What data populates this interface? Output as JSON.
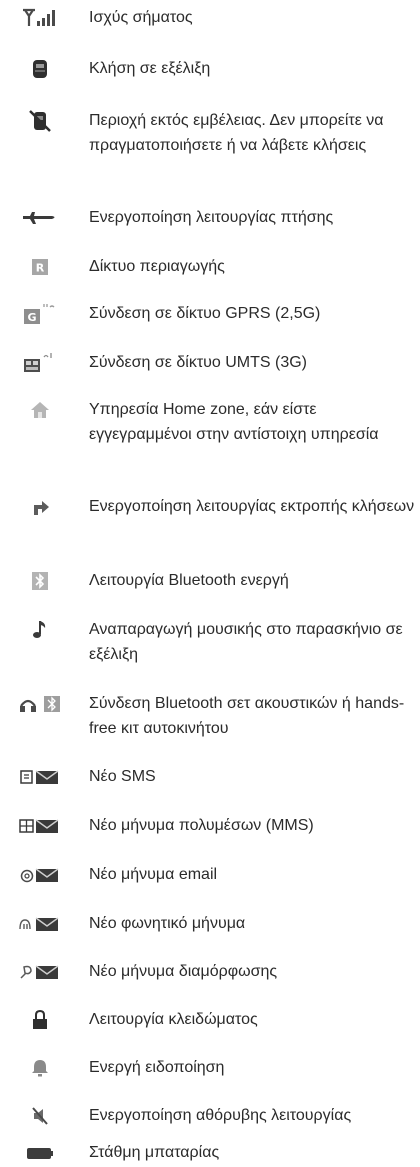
{
  "items": [
    {
      "icon": "signal-strength-icon",
      "text": "Ισχύς σήματος"
    },
    {
      "icon": "call-in-progress-icon",
      "text": "Κλήση σε εξέλιξη"
    },
    {
      "icon": "no-network-icon",
      "text": "Περιοχή εκτός εμβέλειας. Δεν μπορείτε να πραγματοποιήσετε ή να λάβετε κλήσεις"
    },
    {
      "icon": "airplane-mode-icon",
      "text": "Ενεργοποίηση λειτουργίας πτήσης"
    },
    {
      "icon": "roaming-icon",
      "text": "Δίκτυο περιαγωγής"
    },
    {
      "icon": "gprs-icon",
      "text": "Σύνδεση σε δίκτυο GPRS (2,5G)"
    },
    {
      "icon": "umts-3g-icon",
      "text": "Σύνδεση σε δίκτυο UMTS (3G)"
    },
    {
      "icon": "home-zone-icon",
      "text": "Υπηρεσία Home zone, εάν είστε εγγεγραμμένοι στην αντίστοιχη υπηρεσία"
    },
    {
      "icon": "call-divert-icon",
      "text": "Ενεργοποίηση λειτουργίας εκτροπής κλήσεων"
    },
    {
      "icon": "bluetooth-icon",
      "text": "Λειτουργία Bluetooth ενεργή"
    },
    {
      "icon": "background-music-icon",
      "text": "Αναπαραγωγή μουσικής στο παρασκήνιο σε εξέλιξη"
    },
    {
      "icon": "bluetooth-headset-icon",
      "text": "Σύνδεση Bluetooth σετ ακουστικών ή hands-free κιτ αυτοκινήτου"
    },
    {
      "icon": "new-sms-icon",
      "text": "Νέο SMS"
    },
    {
      "icon": "new-mms-icon",
      "text": "Νέο μήνυμα πολυμέσων (MMS)"
    },
    {
      "icon": "new-email-icon",
      "text": "Νέο μήνυμα email"
    },
    {
      "icon": "new-voicemail-icon",
      "text": "Νέο φωνητικό μήνυμα"
    },
    {
      "icon": "new-config-message-icon",
      "text": "Νέο μήνυμα διαμόρφωσης"
    },
    {
      "icon": "lock-icon",
      "text": "Λειτουργία κλειδώματος"
    },
    {
      "icon": "alarm-bell-icon",
      "text": "Ενεργή ειδοποίηση"
    },
    {
      "icon": "silent-mode-icon",
      "text": "Ενεργοποίηση αθόρυβης λειτουργίας"
    },
    {
      "icon": "battery-icon",
      "text": "Στάθμη μπαταρίας"
    }
  ]
}
